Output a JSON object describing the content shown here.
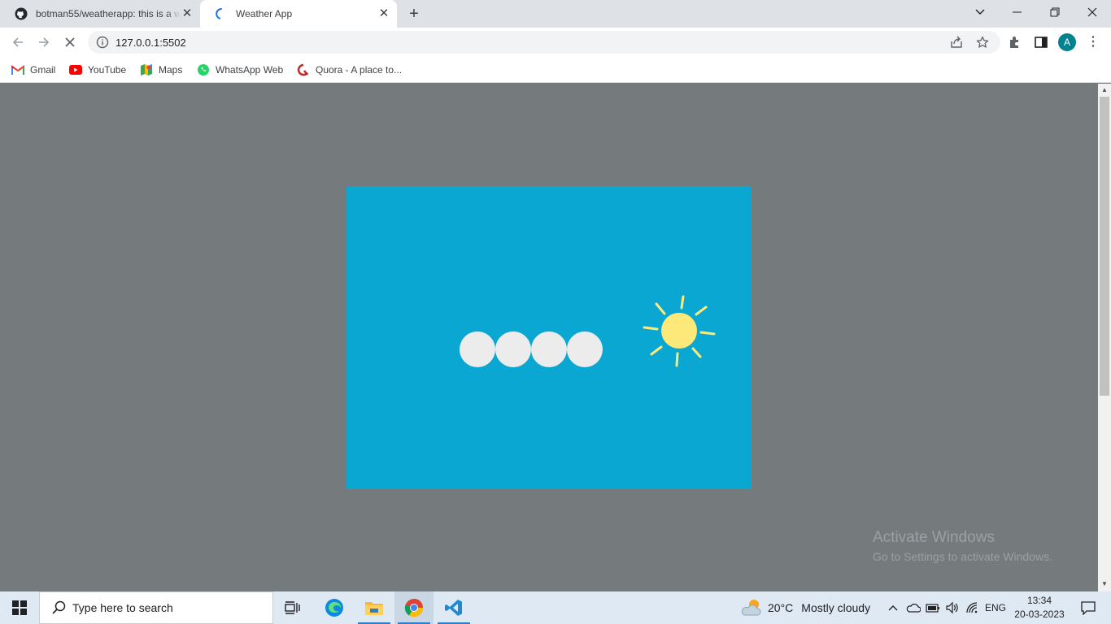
{
  "tabs": [
    {
      "title": "botman55/weatherapp: this is a weather app",
      "icon": "github-icon"
    },
    {
      "title": "Weather App",
      "icon": "loading-spinner-icon"
    }
  ],
  "address": {
    "url": "127.0.0.1:5502"
  },
  "profile": {
    "initial": "A",
    "color": "#00838f"
  },
  "bookmarks": [
    {
      "label": "Gmail",
      "icon": "gmail-icon"
    },
    {
      "label": "YouTube",
      "icon": "youtube-icon"
    },
    {
      "label": "Maps",
      "icon": "maps-icon"
    },
    {
      "label": "WhatsApp Web",
      "icon": "whatsapp-icon"
    },
    {
      "label": "Quora - A place to...",
      "icon": "quora-icon"
    }
  ],
  "page": {
    "background": "#757b7c",
    "card_color": "#0aa7d3",
    "loading_dots": 4,
    "sun_color": "#fde97a"
  },
  "watermark": {
    "line1": "Activate Windows",
    "line2": "Go to Settings to activate Windows."
  },
  "taskbar": {
    "search_placeholder": "Type here to search",
    "apps": [
      "task-view-icon",
      "edge-icon",
      "file-explorer-icon",
      "chrome-icon",
      "vscode-icon"
    ],
    "weather": {
      "temp": "20°C",
      "condition": "Mostly cloudy"
    },
    "language": "ENG",
    "time": "13:34",
    "date": "20-03-2023"
  }
}
